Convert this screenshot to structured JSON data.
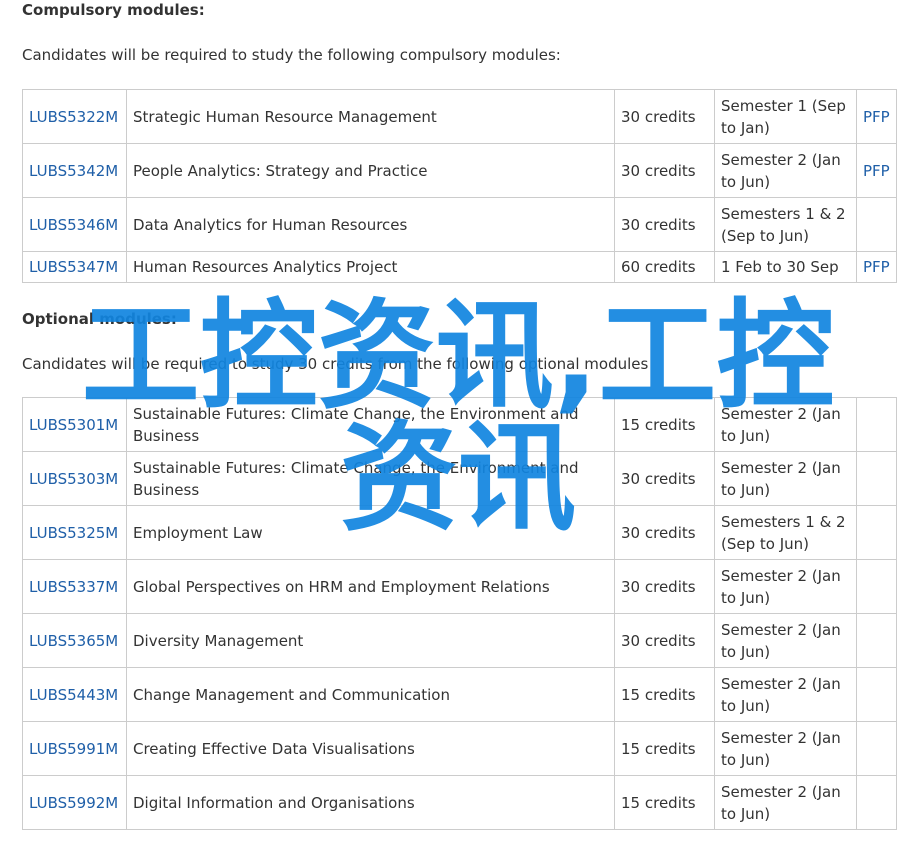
{
  "compulsory": {
    "title": "Compulsory modules:",
    "intro": "Candidates will be required to study the following compulsory modules:",
    "rows": [
      {
        "code": "LUBS5322M",
        "title": "Strategic Human Resource Management",
        "credits": "30 credits",
        "semester": "Semester 1 (Sep to Jan)",
        "pfp": "PFP"
      },
      {
        "code": "LUBS5342M",
        "title": "People Analytics: Strategy and Practice",
        "credits": "30 credits",
        "semester": "Semester 2 (Jan to Jun)",
        "pfp": "PFP"
      },
      {
        "code": "LUBS5346M",
        "title": "Data Analytics for Human Resources",
        "credits": "30 credits",
        "semester": "Semesters 1 & 2 (Sep to Jun)",
        "pfp": ""
      },
      {
        "code": "LUBS5347M",
        "title": "Human Resources Analytics Project",
        "credits": "60 credits",
        "semester": "1 Feb to 30 Sep",
        "pfp": "PFP"
      }
    ]
  },
  "optional": {
    "title": "Optional modules:",
    "intro": "Candidates will be required to study 30 credits from the following optional modules",
    "rows": [
      {
        "code": "LUBS5301M",
        "title": "Sustainable Futures: Climate Change, the Environment and Business",
        "credits": "15 credits",
        "semester": "Semester 2 (Jan to Jun)"
      },
      {
        "code": "LUBS5303M",
        "title": "Sustainable Futures: Climate Change, the Environment and Business",
        "credits": "30 credits",
        "semester": "Semester 2 (Jan to Jun)"
      },
      {
        "code": "LUBS5325M",
        "title": "Employment Law",
        "credits": "30 credits",
        "semester": "Semesters 1 & 2 (Sep to Jun)"
      },
      {
        "code": "LUBS5337M",
        "title": "Global Perspectives on HRM and Employment Relations",
        "credits": "30 credits",
        "semester": "Semester 2 (Jan to Jun)"
      },
      {
        "code": "LUBS5365M",
        "title": "Diversity Management",
        "credits": "30 credits",
        "semester": "Semester 2 (Jan to Jun)"
      },
      {
        "code": "LUBS5443M",
        "title": "Change Management and Communication",
        "credits": "15 credits",
        "semester": "Semester 2 (Jan to Jun)"
      },
      {
        "code": "LUBS5991M",
        "title": "Creating Effective Data Visualisations",
        "credits": "15 credits",
        "semester": "Semester 2 (Jan to Jun)"
      },
      {
        "code": "LUBS5992M",
        "title": "Digital Information and Organisations",
        "credits": "15 credits",
        "semester": "Semester 2 (Jan to Jun)"
      }
    ]
  },
  "watermark": {
    "text": "工控资讯,工控资讯",
    "color": "#1084e0"
  },
  "colors": {
    "link": "#1f5fa8",
    "text": "#333333",
    "border": "#cccccc"
  }
}
